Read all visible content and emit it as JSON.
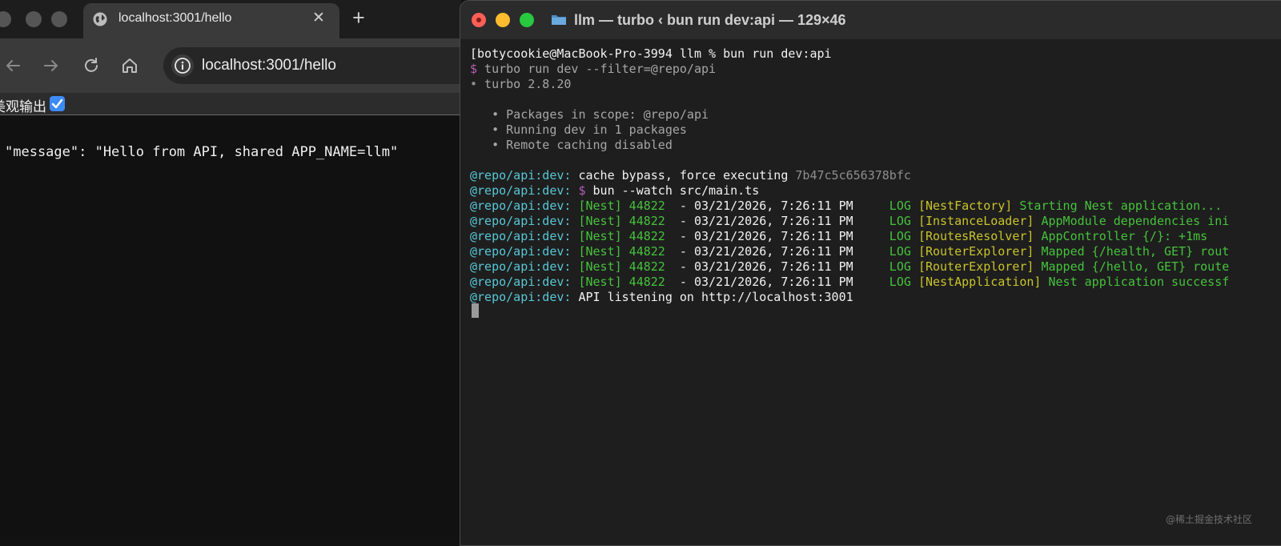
{
  "browser": {
    "tab": {
      "title": "localhost:3001/hello",
      "close_label": "✕"
    },
    "new_tab_label": "+",
    "address": {
      "url": "localhost:3001/hello"
    },
    "pretty_print": {
      "label": "美观输出",
      "checked": true
    },
    "json_line": "\"message\": \"Hello from API, shared APP_NAME=llm\""
  },
  "terminal": {
    "title": "llm — turbo ‹ bun run dev:api — 129×46",
    "lines": {
      "prompt": "[botycookie@MacBook-Pro-3994 llm % bun run dev:api",
      "cmd_dollar": "$",
      "cmd": " turbo run dev --filter=@repo/api",
      "turbo_bullet": "•",
      "turbo_version": " turbo 2.8.20",
      "scope": "   • Packages in scope: @repo/api",
      "running": "   • Running dev in 1 packages",
      "remote": "   • Remote caching disabled",
      "prefix": "@repo/api:dev:",
      "cache_text": " cache bypass, force executing ",
      "cache_hash": "7b47c5c656378bfc",
      "watch_dollar": " $",
      "watch_cmd": " bun --watch src/main.ts",
      "listen": " API listening on http://localhost:3001"
    },
    "nest_logs": [
      {
        "nest": " [Nest] 44822",
        "dash": "  - ",
        "time": "03/21/2026, 7:26:11 PM",
        "level": "     LOG ",
        "ctx": "[NestFactory]",
        "msg": " Starting Nest application..."
      },
      {
        "nest": " [Nest] 44822",
        "dash": "  - ",
        "time": "03/21/2026, 7:26:11 PM",
        "level": "     LOG ",
        "ctx": "[InstanceLoader]",
        "msg": " AppModule dependencies ini"
      },
      {
        "nest": " [Nest] 44822",
        "dash": "  - ",
        "time": "03/21/2026, 7:26:11 PM",
        "level": "     LOG ",
        "ctx": "[RoutesResolver]",
        "msg": " AppController {/}: +1ms"
      },
      {
        "nest": " [Nest] 44822",
        "dash": "  - ",
        "time": "03/21/2026, 7:26:11 PM",
        "level": "     LOG ",
        "ctx": "[RouterExplorer]",
        "msg": " Mapped {/health, GET} rout"
      },
      {
        "nest": " [Nest] 44822",
        "dash": "  - ",
        "time": "03/21/2026, 7:26:11 PM",
        "level": "     LOG ",
        "ctx": "[RouterExplorer]",
        "msg": " Mapped {/hello, GET} route"
      },
      {
        "nest": " [Nest] 44822",
        "dash": "  - ",
        "time": "03/21/2026, 7:26:11 PM",
        "level": "     LOG ",
        "ctx": "[NestApplication]",
        "msg": " Nest application successf"
      }
    ]
  },
  "watermark": "@稀土掘金技术社区",
  "colors": {
    "traffic_close": "#ff5f57",
    "traffic_min": "#febc2e",
    "traffic_max": "#28c840",
    "prefix_cyan": "#58c7d6",
    "log_green": "#46c23c",
    "context_yellow": "#c9c32b",
    "dollar_purple": "#b25fb7",
    "checkbox_blue": "#3d8bf5"
  },
  "icons": [
    "globe-icon",
    "close-icon",
    "plus-icon",
    "back-arrow-icon",
    "forward-arrow-icon",
    "reload-icon",
    "home-icon",
    "info-icon",
    "checkbox-checked-icon",
    "folder-icon"
  ]
}
